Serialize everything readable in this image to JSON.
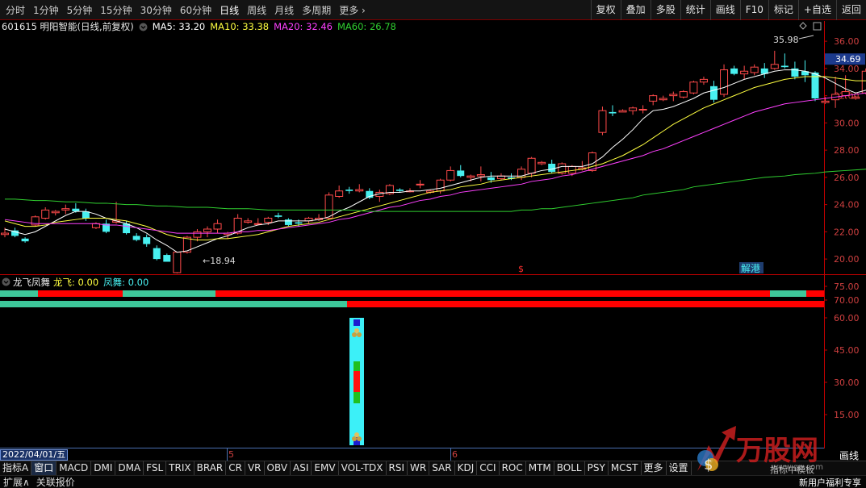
{
  "topbar": {
    "periods": [
      "分时",
      "1分钟",
      "5分钟",
      "15分钟",
      "30分钟",
      "60分钟",
      "日线",
      "周线",
      "月线",
      "多周期"
    ],
    "active_period": "日线",
    "more_label": "更多",
    "more_icon": "chevron-right-icon",
    "right_buttons": [
      "复权",
      "叠加",
      "多股",
      "统计",
      "画线",
      "F10",
      "标记",
      "+自选",
      "返回"
    ]
  },
  "info": {
    "stock": "601615 明阳智能(日线,前复权)",
    "toggle_icon": "chevron-down-circle-icon",
    "ma5": "MA5: 33.20",
    "ma10": "MA10: 33.38",
    "ma20": "MA20: 32.46",
    "ma60": "MA60: 26.78"
  },
  "pane2": {
    "toggle_icon": "chevron-down-circle-icon",
    "name": "龙飞凤舞",
    "long_fly": "龙飞: 0.00",
    "phoenix": "凤舞: 0.00"
  },
  "colors": {
    "background": "#000000",
    "up": "#ff4a4a",
    "down": "#48f0f0",
    "ma5": "#ffffff",
    "ma10": "#ffff40",
    "ma20": "#ff40ff",
    "ma60": "#30d030",
    "strip_green": "#3ec79a",
    "strip_red": "#ff0000",
    "axis": "#c00000",
    "price_box": "#1c3a8c"
  },
  "annotations": {
    "high_label": "35.98",
    "low_label": "18.94",
    "current_price": "34.69",
    "jiegang": "解港",
    "marker": "$",
    "date_label": "2022/04/01/五",
    "month5": "5",
    "month6": "6"
  },
  "chart_data": [
    {
      "type": "candlestick",
      "title": "601615 明阳智能(日线,前复权)",
      "y_ticks": [
        "36.00",
        "34.00",
        "32.00",
        "30.00",
        "28.00",
        "26.00",
        "24.00",
        "22.00",
        "20.00"
      ],
      "ylim": [
        19.0,
        36.6
      ],
      "ohlc": [
        [
          21.8,
          22.3,
          21.6,
          21.9
        ],
        [
          22.1,
          22.3,
          21.6,
          21.7
        ],
        [
          21.5,
          21.6,
          21.2,
          21.3
        ],
        [
          22.5,
          23.2,
          22.4,
          23.1
        ],
        [
          23.0,
          23.8,
          22.9,
          23.6
        ],
        [
          23.4,
          23.6,
          23.2,
          23.5
        ],
        [
          23.6,
          24.0,
          23.3,
          23.7
        ],
        [
          23.7,
          24.1,
          23.4,
          23.5
        ],
        [
          23.5,
          23.7,
          22.8,
          23.0
        ],
        [
          22.3,
          22.7,
          22.2,
          22.6
        ],
        [
          22.6,
          22.9,
          21.9,
          22.0
        ],
        [
          22.7,
          24.2,
          22.6,
          22.8
        ],
        [
          22.6,
          22.8,
          21.8,
          21.9
        ],
        [
          21.7,
          21.9,
          21.3,
          21.4
        ],
        [
          21.6,
          21.8,
          20.9,
          21.1
        ],
        [
          20.8,
          21.0,
          19.9,
          20.0
        ],
        [
          20.3,
          20.4,
          19.8,
          19.8
        ],
        [
          19.0,
          20.5,
          18.94,
          20.5
        ],
        [
          20.5,
          21.7,
          20.4,
          21.6
        ],
        [
          21.6,
          22.2,
          21.3,
          22.0
        ],
        [
          22.0,
          22.4,
          21.6,
          22.2
        ],
        [
          22.2,
          22.9,
          21.9,
          22.6
        ],
        [
          21.8,
          22.0,
          21.5,
          21.9
        ],
        [
          21.9,
          23.3,
          21.8,
          23.0
        ],
        [
          22.7,
          23.0,
          22.6,
          22.8
        ],
        [
          22.6,
          23.0,
          22.5,
          22.6
        ],
        [
          22.7,
          23.1,
          22.5,
          23.0
        ],
        [
          23.2,
          23.4,
          23.0,
          23.1
        ],
        [
          22.9,
          23.0,
          22.4,
          22.5
        ],
        [
          22.7,
          22.9,
          22.4,
          22.6
        ],
        [
          22.8,
          23.1,
          22.6,
          23.0
        ],
        [
          22.9,
          23.3,
          22.8,
          23.0
        ],
        [
          23.0,
          24.9,
          22.9,
          24.7
        ],
        [
          24.6,
          25.4,
          24.5,
          25.0
        ],
        [
          25.1,
          25.3,
          24.8,
          25.0
        ],
        [
          25.0,
          25.5,
          24.9,
          25.1
        ],
        [
          25.0,
          25.2,
          24.4,
          24.5
        ],
        [
          24.6,
          25.1,
          24.2,
          24.9
        ],
        [
          24.8,
          25.5,
          24.7,
          25.4
        ],
        [
          25.1,
          25.2,
          24.9,
          25.0
        ],
        [
          25.0,
          25.2,
          24.9,
          25.0
        ],
        [
          25.5,
          25.8,
          25.2,
          25.5
        ],
        [
          24.9,
          25.1,
          24.8,
          25.0
        ],
        [
          25.0,
          25.9,
          24.8,
          25.8
        ],
        [
          25.8,
          26.8,
          25.7,
          26.5
        ],
        [
          26.5,
          26.9,
          26.0,
          26.1
        ],
        [
          26.0,
          26.2,
          25.7,
          26.1
        ],
        [
          26.1,
          26.8,
          25.7,
          26.2
        ],
        [
          26.0,
          26.4,
          25.6,
          25.8
        ],
        [
          25.9,
          26.3,
          25.8,
          26.1
        ],
        [
          26.0,
          26.3,
          25.8,
          25.9
        ],
        [
          26.0,
          26.8,
          25.8,
          26.6
        ],
        [
          26.3,
          27.5,
          26.0,
          27.4
        ],
        [
          27.0,
          27.2,
          26.9,
          27.1
        ],
        [
          27.0,
          27.3,
          26.3,
          26.4
        ],
        [
          26.3,
          27.1,
          26.2,
          27.0
        ],
        [
          26.3,
          26.9,
          26.1,
          26.8
        ],
        [
          26.6,
          27.2,
          26.5,
          26.7
        ],
        [
          26.5,
          27.9,
          26.4,
          27.8
        ],
        [
          29.3,
          31.2,
          29.1,
          30.9
        ],
        [
          30.8,
          31.3,
          30.5,
          30.7
        ],
        [
          30.8,
          31.0,
          30.8,
          30.9
        ],
        [
          30.9,
          31.2,
          30.6,
          31.1
        ],
        [
          31.0,
          31.3,
          30.7,
          31.0
        ],
        [
          31.6,
          32.1,
          31.3,
          32.0
        ],
        [
          31.7,
          32.0,
          31.6,
          31.8
        ],
        [
          32.0,
          32.3,
          31.6,
          32.1
        ],
        [
          31.9,
          32.4,
          31.8,
          32.3
        ],
        [
          32.2,
          33.1,
          32.1,
          33.0
        ],
        [
          33.0,
          33.4,
          32.8,
          33.2
        ],
        [
          32.7,
          33.1,
          31.5,
          31.7
        ],
        [
          32.1,
          34.3,
          31.9,
          33.9
        ],
        [
          34.0,
          34.2,
          33.5,
          33.6
        ],
        [
          33.6,
          34.2,
          33.2,
          33.8
        ],
        [
          33.7,
          34.3,
          33.5,
          34.1
        ],
        [
          34.0,
          34.4,
          33.3,
          33.6
        ],
        [
          34.0,
          35.3,
          33.9,
          34.3
        ],
        [
          34.2,
          35.1,
          34.0,
          34.1
        ],
        [
          34.0,
          34.5,
          33.2,
          33.4
        ],
        [
          33.8,
          34.6,
          33.0,
          33.5
        ],
        [
          33.7,
          33.8,
          31.6,
          31.8
        ],
        [
          31.5,
          31.9,
          31.4,
          31.6
        ],
        [
          31.7,
          33.4,
          31.1,
          32.1
        ],
        [
          32.0,
          33.5,
          31.8,
          32.3
        ],
        [
          31.8,
          32.0,
          31.7,
          31.9
        ],
        [
          32.2,
          34.0,
          32.1,
          33.8
        ],
        [
          33.7,
          34.1,
          33.5,
          33.6
        ],
        [
          33.6,
          34.3,
          33.1,
          34.2
        ],
        [
          33.9,
          35.98,
          33.7,
          34.69
        ]
      ],
      "ma_series": [
        {
          "name": "MA5",
          "values": [
            22.2,
            22.0,
            21.8,
            22.0,
            22.4,
            22.8,
            23.2,
            23.5,
            23.5,
            23.3,
            23.0,
            22.8,
            22.6,
            22.3,
            21.9,
            21.4,
            21.0,
            20.5,
            20.6,
            20.9,
            21.2,
            21.5,
            21.7,
            22.0,
            22.3,
            22.5,
            22.6,
            22.8,
            22.8,
            22.8,
            22.8,
            22.9,
            23.1,
            23.5,
            23.8,
            24.2,
            24.6,
            24.8,
            24.9,
            24.9,
            25.0,
            25.0,
            25.1,
            25.2,
            25.4,
            25.6,
            25.8,
            26.0,
            26.1,
            26.1,
            26.1,
            26.1,
            26.3,
            26.5,
            26.6,
            26.8,
            26.8,
            26.8,
            27.0,
            27.5,
            28.2,
            28.8,
            29.5,
            30.3,
            30.9,
            31.0,
            31.2,
            31.5,
            31.8,
            32.2,
            32.4,
            32.6,
            32.9,
            33.2,
            33.4,
            33.6,
            33.8,
            33.9,
            33.9,
            33.8,
            33.6,
            33.3,
            32.9,
            32.5,
            32.2,
            32.4,
            32.7,
            33.0,
            33.2
          ]
        },
        {
          "name": "MA10",
          "values": [
            22.8,
            22.6,
            22.4,
            22.4,
            22.5,
            22.7,
            22.8,
            22.9,
            23.0,
            23.0,
            23.0,
            22.9,
            22.8,
            22.6,
            22.4,
            22.1,
            21.8,
            21.6,
            21.5,
            21.4,
            21.4,
            21.5,
            21.5,
            21.6,
            21.7,
            21.8,
            22.0,
            22.2,
            22.4,
            22.5,
            22.6,
            22.7,
            22.9,
            23.1,
            23.3,
            23.5,
            23.7,
            23.9,
            24.1,
            24.3,
            24.5,
            24.7,
            24.9,
            25.0,
            25.1,
            25.3,
            25.4,
            25.5,
            25.7,
            25.8,
            25.9,
            26.0,
            26.1,
            26.2,
            26.3,
            26.4,
            26.5,
            26.6,
            26.8,
            27.0,
            27.3,
            27.6,
            28.0,
            28.4,
            28.9,
            29.4,
            29.9,
            30.3,
            30.7,
            31.1,
            31.4,
            31.7,
            32.0,
            32.3,
            32.6,
            32.8,
            33.0,
            33.2,
            33.3,
            33.4,
            33.4,
            33.4,
            33.3,
            33.2,
            33.1,
            33.1,
            33.2,
            33.3,
            33.38
          ]
        },
        {
          "name": "MA20",
          "values": [
            22.9,
            22.8,
            22.7,
            22.6,
            22.6,
            22.6,
            22.6,
            22.6,
            22.6,
            22.6,
            22.5,
            22.5,
            22.4,
            22.3,
            22.2,
            22.1,
            22.0,
            21.9,
            21.9,
            21.9,
            21.9,
            21.9,
            21.9,
            22.0,
            22.0,
            22.1,
            22.1,
            22.2,
            22.3,
            22.4,
            22.5,
            22.6,
            22.7,
            22.9,
            23.0,
            23.2,
            23.4,
            23.6,
            23.8,
            23.9,
            24.1,
            24.3,
            24.4,
            24.6,
            24.7,
            24.9,
            25.0,
            25.1,
            25.2,
            25.3,
            25.4,
            25.5,
            25.7,
            25.8,
            25.9,
            26.1,
            26.2,
            26.4,
            26.6,
            26.8,
            27.0,
            27.2,
            27.4,
            27.6,
            27.9,
            28.1,
            28.4,
            28.7,
            29.0,
            29.3,
            29.6,
            29.9,
            30.2,
            30.5,
            30.8,
            31.0,
            31.2,
            31.4,
            31.5,
            31.6,
            31.7,
            31.8,
            31.9,
            32.0,
            32.1,
            32.2,
            32.3,
            32.4,
            32.46
          ]
        },
        {
          "name": "MA60",
          "values": [
            24.4,
            24.4,
            24.35,
            24.3,
            24.3,
            24.25,
            24.2,
            24.2,
            24.15,
            24.1,
            24.1,
            24.05,
            24.0,
            24.0,
            23.95,
            23.9,
            23.9,
            23.85,
            23.8,
            23.8,
            23.8,
            23.75,
            23.7,
            23.7,
            23.7,
            23.65,
            23.6,
            23.6,
            23.6,
            23.6,
            23.6,
            23.6,
            23.6,
            23.6,
            23.6,
            23.55,
            23.5,
            23.5,
            23.5,
            23.5,
            23.5,
            23.5,
            23.5,
            23.5,
            23.5,
            23.5,
            23.5,
            23.5,
            23.5,
            23.5,
            23.5,
            23.6,
            23.6,
            23.7,
            23.7,
            23.8,
            23.9,
            24.0,
            24.1,
            24.2,
            24.3,
            24.4,
            24.5,
            24.7,
            24.8,
            24.9,
            25.0,
            25.1,
            25.3,
            25.4,
            25.5,
            25.6,
            25.7,
            25.8,
            25.9,
            26.0,
            26.05,
            26.1,
            26.2,
            26.25,
            26.3,
            26.4,
            26.45,
            26.5,
            26.55,
            26.6,
            26.65,
            26.7,
            26.78
          ]
        }
      ]
    },
    {
      "type": "bar",
      "title": "龙飞凤舞",
      "y_ticks": [
        "75.00",
        "70.00",
        "60.00",
        "45.00",
        "30.00",
        "15.00"
      ],
      "series": [
        {
          "name": "龙飞",
          "values": [
            0.0
          ]
        },
        {
          "name": "凤舞",
          "values": [
            0.0
          ]
        }
      ]
    }
  ],
  "tabs": [
    "指标A",
    "窗口",
    "MACD",
    "DMI",
    "DMA",
    "FSL",
    "TRIX",
    "BRAR",
    "CR",
    "VR",
    "OBV",
    "ASI",
    "EMV",
    "VOL-TDX",
    "RSI",
    "WR",
    "SAR",
    "KDJ",
    "CCI",
    "ROC",
    "MTM",
    "BOLL",
    "PSY",
    "MCST",
    "更多",
    "设置"
  ],
  "selected_tab": "窗口",
  "bottom": {
    "expand": "扩展∧",
    "quote": "关联报价"
  },
  "watermark": {
    "text": "万股网",
    "sub1": "www.gp.com",
    "sub2": "新用户福利专享",
    "sub3": "指标中模板"
  },
  "side_label": "画线"
}
